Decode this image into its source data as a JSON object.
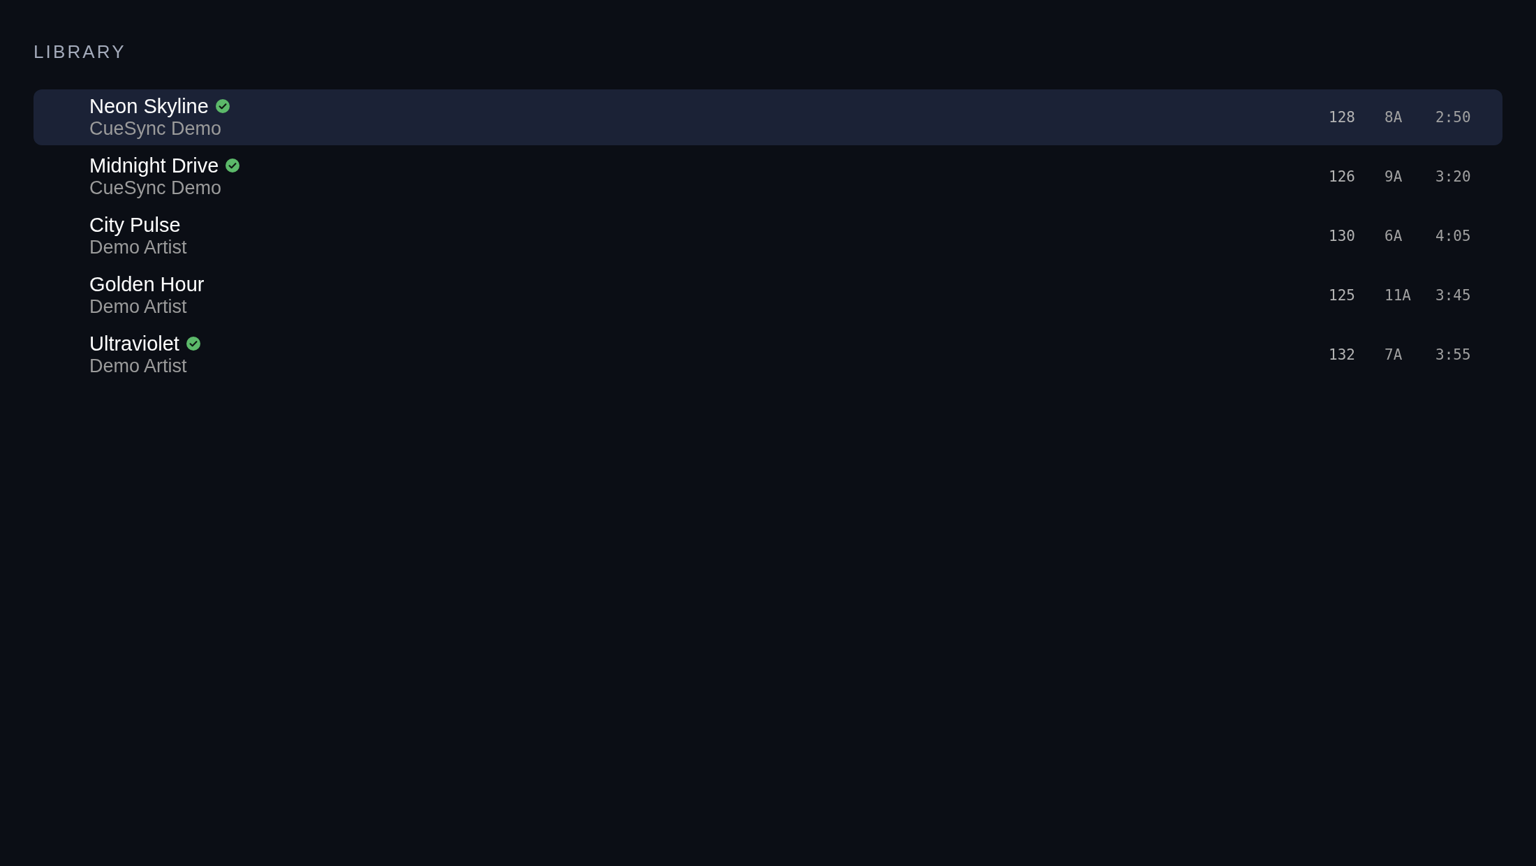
{
  "section_title": "LIBRARY",
  "tracks": [
    {
      "title": "Neon Skyline",
      "artist": "CueSync Demo",
      "verified": true,
      "selected": true,
      "bpm": "128",
      "key": "8A",
      "duration": "2:50"
    },
    {
      "title": "Midnight Drive",
      "artist": "CueSync Demo",
      "verified": true,
      "selected": false,
      "bpm": "126",
      "key": "9A",
      "duration": "3:20"
    },
    {
      "title": "City Pulse",
      "artist": "Demo Artist",
      "verified": false,
      "selected": false,
      "bpm": "130",
      "key": "6A",
      "duration": "4:05"
    },
    {
      "title": "Golden Hour",
      "artist": "Demo Artist",
      "verified": false,
      "selected": false,
      "bpm": "125",
      "key": "11A",
      "duration": "3:45"
    },
    {
      "title": "Ultraviolet",
      "artist": "Demo Artist",
      "verified": true,
      "selected": false,
      "bpm": "132",
      "key": "7A",
      "duration": "3:55"
    }
  ]
}
